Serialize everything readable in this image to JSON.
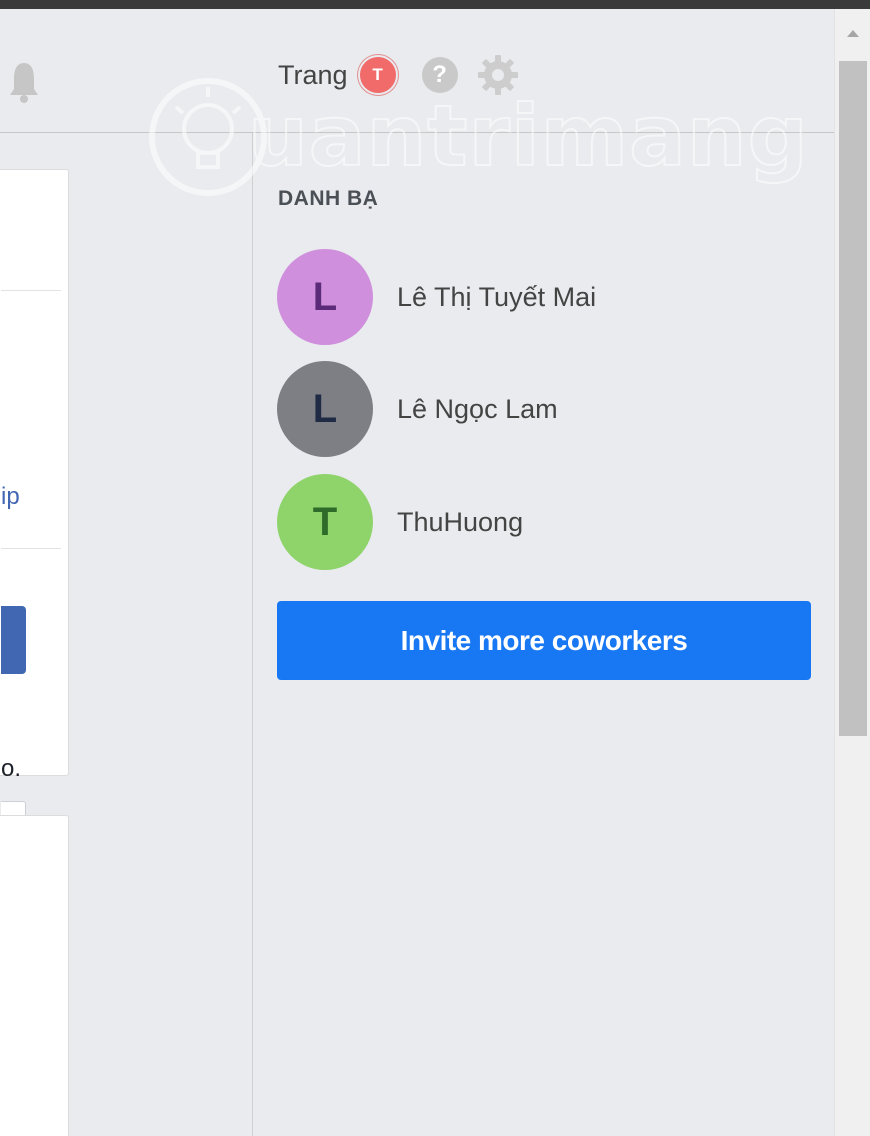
{
  "header": {
    "username": "Trang",
    "avatar_letter": "T",
    "help_label": "?"
  },
  "left_panel": {
    "link_fragment": "ip",
    "text_fragment": "o."
  },
  "contacts_section": {
    "title": "DANH BẠ",
    "contacts": [
      {
        "initial": "L",
        "name": "Lê Thị Tuyết Mai",
        "avatar_bg": "#cf8fdc",
        "letter_color": "#5b2a78"
      },
      {
        "initial": "L",
        "name": "Lê Ngọc Lam",
        "avatar_bg": "#7d7f85",
        "letter_color": "#1f2a44"
      },
      {
        "initial": "T",
        "name": "ThuHuong",
        "avatar_bg": "#8fd36b",
        "letter_color": "#2f6b2a"
      }
    ],
    "invite_button_label": "Invite more coworkers"
  },
  "watermark": {
    "text": "uantrimang"
  },
  "colors": {
    "accent": "#1877f2",
    "user_avatar_bg": "#f16b6b",
    "background": "#e9ebee",
    "legacy_blue": "#4267b2"
  },
  "icons": {
    "notifications": "bell-icon",
    "help": "help-icon",
    "settings": "gear-icon",
    "scroll": "scroll-up-arrow-icon",
    "watermark_logo": "lightbulb-icon"
  }
}
